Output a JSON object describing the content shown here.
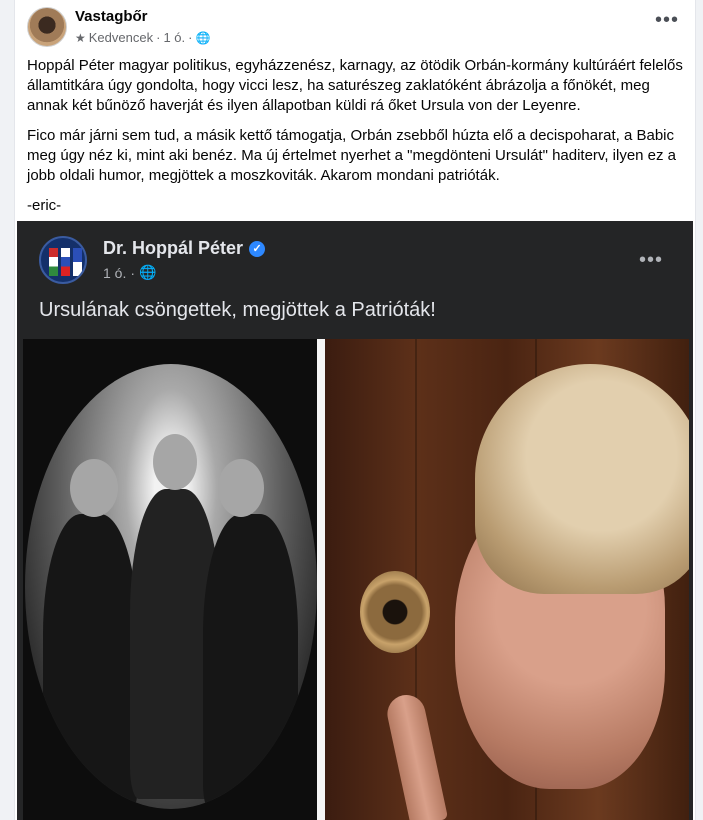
{
  "post": {
    "author": "Vastagbőr",
    "audience": "Kedvencek",
    "time": "1 ó.",
    "separator": "·",
    "more_label": "•••",
    "paragraphs": [
      "Hoppál Péter magyar politikus, egyházzenész, karnagy, az ötödik Orbán-kormány kultúráért felelős államtitkára úgy gondolta, hogy vicci lesz, ha saturészeg zaklatóként ábrázolja a főnökét, meg annak  két bűnöző haverját és ilyen állapotban küldi rá őket Ursula von der Leyenre.",
      "Fico már járni sem tud, a másik kettő támogatja, Orbán zsebből húzta elő a decispoharat, a Babic meg úgy néz ki, mint aki benéz. Ma új értelmet nyerhet a \"megdönteni Ursulát\" haditerv, ilyen ez a jobb oldali humor, megjöttek a moszkoviták. Akarom mondani patrióták.",
      "-eric-"
    ]
  },
  "shared_post": {
    "author": "Dr. Hoppál Péter",
    "verified_icon": "✓",
    "time": "1 ó.",
    "separator": "·",
    "more_label": "•••",
    "text": "Ursulának csöngettek, megjöttek a Patrióták!"
  },
  "icons": {
    "star": "★",
    "globe": "🌐"
  },
  "colors": {
    "verified": "#2d88ff",
    "shared_bg": "#242526"
  }
}
